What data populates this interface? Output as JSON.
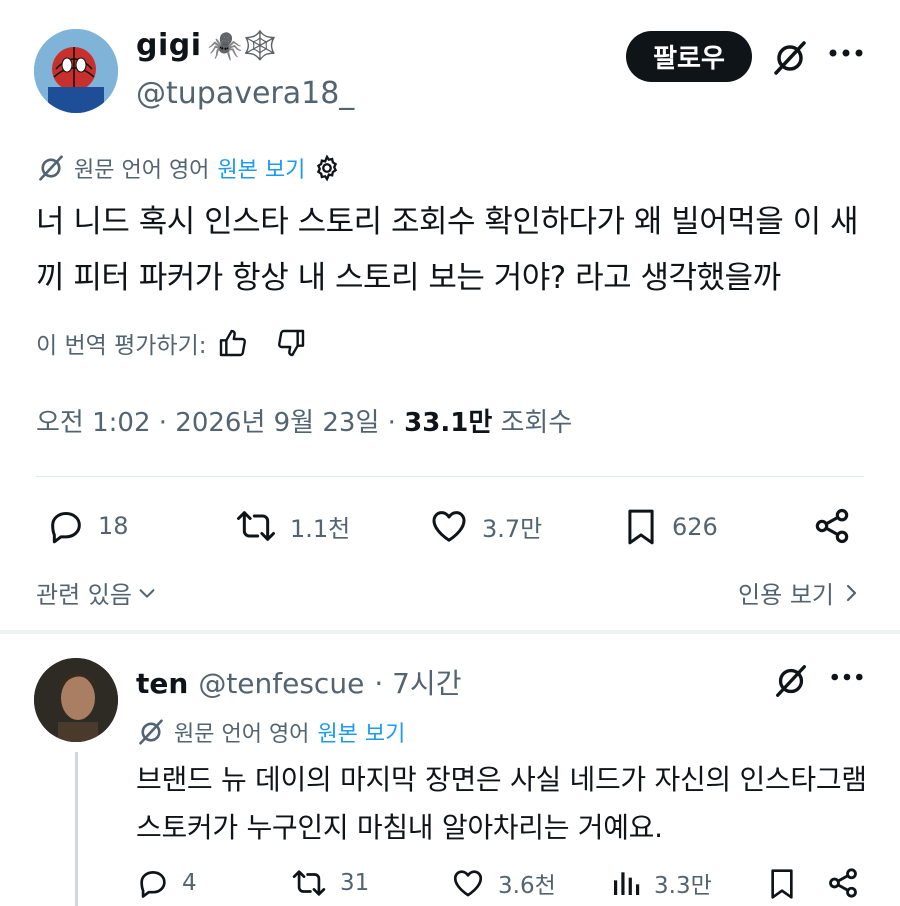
{
  "post": {
    "author": {
      "display_name": "gigi",
      "emoji": "🕷️🕸️",
      "handle": "@tupavera18_"
    },
    "follow_label": "팔로우",
    "translation": {
      "source_text": "원문 언어 영어",
      "show_original": "원본 보기"
    },
    "text": "너 니드 혹시 인스타 스토리 조회수 확인하다가 왜 빌어먹을 이 새끼 피터 파커가 항상 내 스토리 보는 거야? 라고 생각했을까",
    "rate_translation": "이 번역 평가하기:",
    "meta": {
      "timestamp": "오전 1:02 · 2026년 9월 23일 · ",
      "views_count": "33.1만",
      "views_label": " 조회수"
    },
    "actions": {
      "replies": "18",
      "reposts": "1.1천",
      "likes": "3.7만",
      "bookmarks": "626"
    },
    "related": "관련 있음",
    "quotes": "인용 보기"
  },
  "reply": {
    "author": {
      "display_name": "ten",
      "handle": "@tenfescue",
      "time": "· 7시간"
    },
    "translation": {
      "source_text": "원문 언어 영어",
      "show_original": "원본 보기"
    },
    "text": "브랜드 뉴 데이의 마지막 장면은 사실 네드가 자신의 인스타그램 스토커가 누구인지 마침내 알아차리는 거예요.",
    "actions": {
      "replies": "4",
      "reposts": "31",
      "likes": "3.6천",
      "views": "3.3만"
    }
  },
  "colors": {
    "text": "#0f1419",
    "muted": "#536471",
    "link": "#1d9bf0",
    "divider": "#e1e8ed"
  }
}
